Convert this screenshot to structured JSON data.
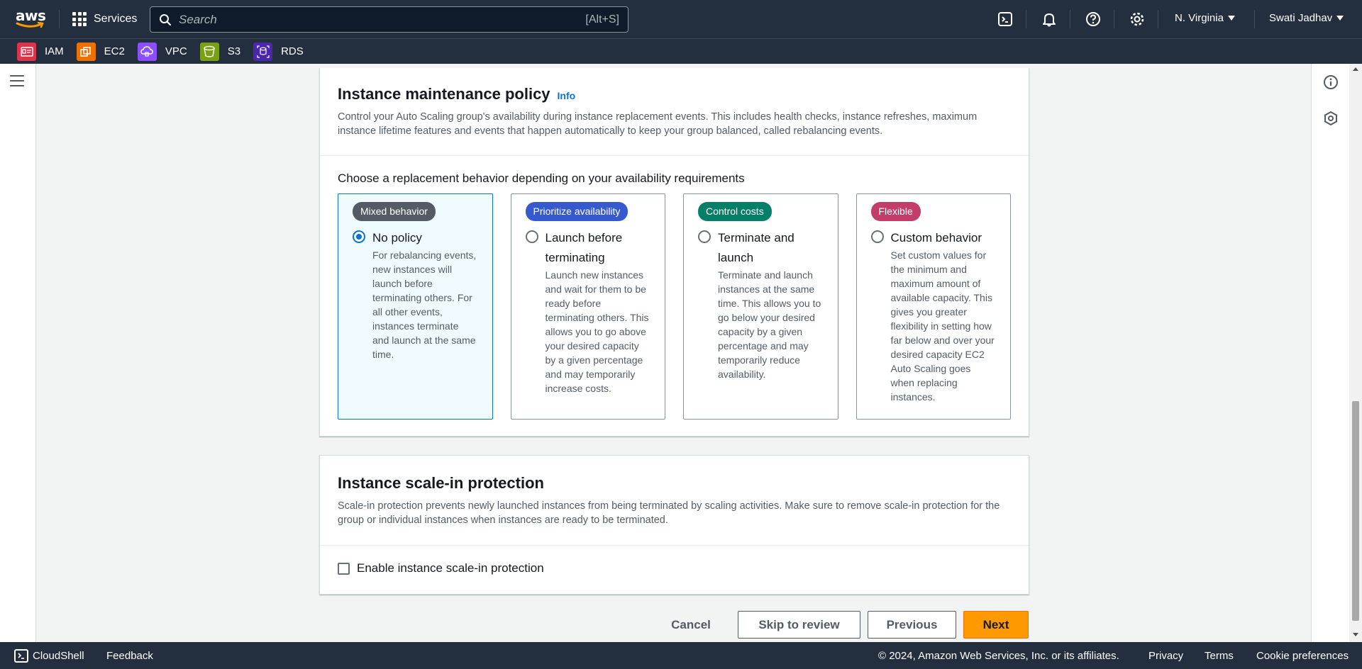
{
  "topnav": {
    "logo_text": "aws",
    "services_label": "Services",
    "search_placeholder": "Search",
    "search_shortcut": "[Alt+S]",
    "region": "N. Virginia",
    "user": "Swati Jadhav"
  },
  "favorites": [
    {
      "label": "IAM",
      "color": "#dd344c"
    },
    {
      "label": "EC2",
      "color": "#ed7100"
    },
    {
      "label": "VPC",
      "color": "#8c4fff"
    },
    {
      "label": "S3",
      "color": "#7aa116"
    },
    {
      "label": "RDS",
      "color": "#4d27aa"
    }
  ],
  "maintenance": {
    "title": "Instance maintenance policy",
    "info": "Info",
    "description": "Control your Auto Scaling group's availability during instance replacement events. This includes health checks, instance refreshes, maximum instance lifetime features and events that happen automatically to keep your group balanced, called rebalancing events.",
    "choose_label": "Choose a replacement behavior depending on your availability requirements",
    "options": [
      {
        "badge": "Mixed behavior",
        "badge_color": "#545b64",
        "title": "No policy",
        "description": "For rebalancing events, new instances will launch before terminating others. For all other events, instances terminate and launch at the same time.",
        "selected": true
      },
      {
        "badge": "Prioritize availability",
        "badge_color": "#3759ce",
        "title": "Launch before terminating",
        "description": "Launch new instances and wait for them to be ready before terminating others. This allows you to go above your desired capacity by a given percentage and may temporarily increase costs.",
        "selected": false
      },
      {
        "badge": "Control costs",
        "badge_color": "#067f68",
        "title": "Terminate and launch",
        "description": "Terminate and launch instances at the same time. This allows you to go below your desired capacity by a given percentage and may temporarily reduce availability.",
        "selected": false
      },
      {
        "badge": "Flexible",
        "badge_color": "#c33d69",
        "title": "Custom behavior",
        "description": "Set custom values for the minimum and maximum amount of available capacity. This gives you greater flexibility in setting how far below and over your desired capacity EC2 Auto Scaling goes when replacing instances.",
        "selected": false
      }
    ]
  },
  "scalein": {
    "title": "Instance scale-in protection",
    "description": "Scale-in protection prevents newly launched instances from being terminated by scaling activities. Make sure to remove scale-in protection for the group or individual instances when instances are ready to be terminated.",
    "checkbox_label": "Enable instance scale-in protection",
    "checked": false
  },
  "actions": {
    "cancel": "Cancel",
    "skip": "Skip to review",
    "previous": "Previous",
    "next": "Next"
  },
  "footer": {
    "cloudshell": "CloudShell",
    "feedback": "Feedback",
    "copyright": "© 2024, Amazon Web Services, Inc. or its affiliates.",
    "privacy": "Privacy",
    "terms": "Terms",
    "cookies": "Cookie preferences"
  }
}
